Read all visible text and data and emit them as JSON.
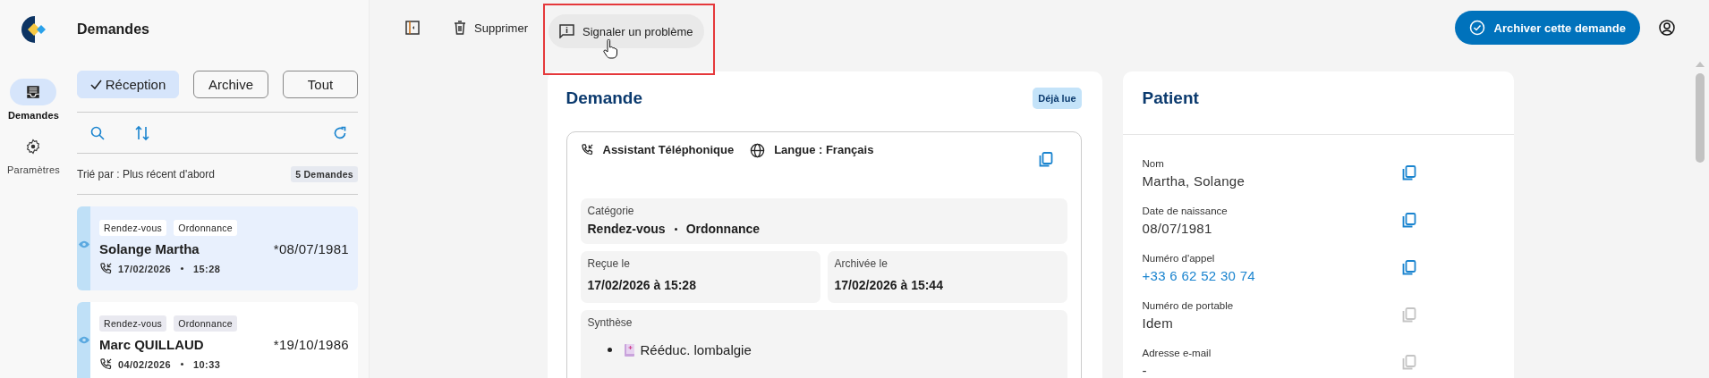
{
  "nav": {
    "items": [
      {
        "label": "Demandes",
        "kind": "inbox",
        "selected": true
      },
      {
        "label": "Paramètres",
        "kind": "gear",
        "selected": false
      }
    ]
  },
  "list": {
    "title": "Demandes",
    "filters": [
      {
        "label": "Réception",
        "selected": true
      },
      {
        "label": "Archive",
        "selected": false
      },
      {
        "label": "Tout",
        "selected": false
      }
    ],
    "sort_label": "Trié par : Plus récent d'abord",
    "count": "5 Demandes",
    "cards": [
      {
        "tags": [
          "Rendez-vous",
          "Ordonnance"
        ],
        "name": "Solange Martha",
        "birthdate": "*08/07/1981",
        "date": "17/02/2026",
        "time": "15:28",
        "selected": true
      },
      {
        "tags": [
          "Rendez-vous",
          "Ordonnance"
        ],
        "name": "Marc QUILLAUD",
        "birthdate": "*19/10/1986",
        "date": "04/02/2026",
        "time": "10:33",
        "selected": false
      }
    ]
  },
  "toolbar": {
    "items": [
      {
        "kind": "collapse"
      },
      {
        "kind": "delete",
        "label": "Supprimer"
      },
      {
        "kind": "report",
        "label": "Signaler un problème",
        "hovered": true,
        "highlighted": true
      }
    ],
    "primary_action": "Archiver cette demande"
  },
  "demande": {
    "title": "Demande",
    "status": "Déjà lue",
    "source": "Assistant Téléphonique",
    "language": "Langue : Français",
    "category": {
      "label": "Catégorie",
      "values": [
        "Rendez-vous",
        "Ordonnance"
      ]
    },
    "received": {
      "label": "Reçue le",
      "value": "17/02/2026 à 15:28"
    },
    "archived": {
      "label": "Archivée le",
      "value": "17/02/2026 à 15:44"
    },
    "synthesis": {
      "label": "Synthèse",
      "items": [
        "Rééduc. lombalgie"
      ]
    }
  },
  "patient": {
    "title": "Patient",
    "fields": [
      {
        "label": "Nom",
        "value": "Martha, Solange",
        "kind": "text",
        "copy_enabled": true
      },
      {
        "label": "Date de naissance",
        "value": "08/07/1981",
        "kind": "text",
        "copy_enabled": true
      },
      {
        "label": "Numéro d'appel",
        "value": "+33 6 62 52 30 74",
        "kind": "link",
        "copy_enabled": true
      },
      {
        "label": "Numéro de portable",
        "value": "Idem",
        "kind": "text",
        "copy_enabled": false
      },
      {
        "label": "Adresse e-mail",
        "value": "-",
        "kind": "text",
        "copy_enabled": false
      }
    ]
  }
}
